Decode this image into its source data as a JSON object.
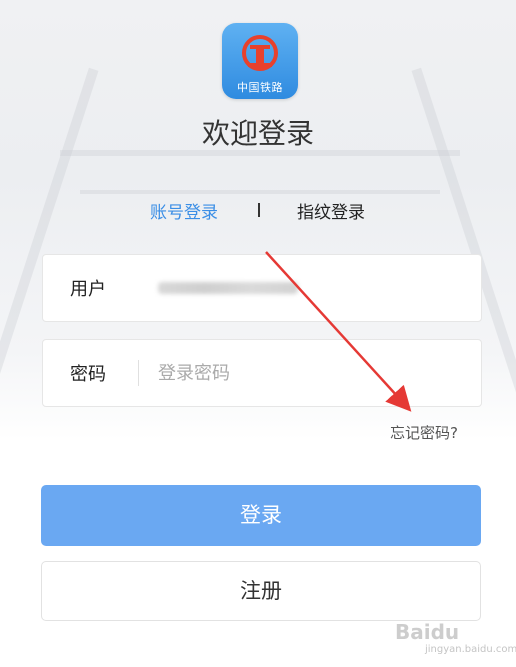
{
  "app": {
    "logo_text": "中国铁路",
    "welcome": "欢迎登录"
  },
  "tabs": {
    "account": "账号登录",
    "fingerprint": "指纹登录"
  },
  "form": {
    "user_label": "用户",
    "pass_label": "密码",
    "pass_placeholder": "登录密码",
    "forgot": "忘记密码?"
  },
  "buttons": {
    "login": "登录",
    "register": "注册"
  },
  "watermark": {
    "brand": "Baidu",
    "sub": "jingyan.baidu.com"
  },
  "colors": {
    "accent": "#3a8ee6",
    "login_button": "#6aa8f2",
    "logo": "#2f8be0",
    "annotation_arrow": "#e53935"
  }
}
